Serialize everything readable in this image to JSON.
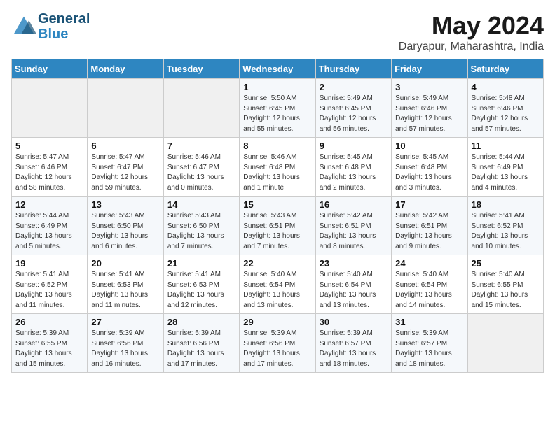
{
  "header": {
    "logo_line1": "General",
    "logo_line2": "Blue",
    "month_title": "May 2024",
    "location": "Daryapur, Maharashtra, India"
  },
  "days_of_week": [
    "Sunday",
    "Monday",
    "Tuesday",
    "Wednesday",
    "Thursday",
    "Friday",
    "Saturday"
  ],
  "weeks": [
    [
      {
        "day": "",
        "sunrise": "",
        "sunset": "",
        "daylight": ""
      },
      {
        "day": "",
        "sunrise": "",
        "sunset": "",
        "daylight": ""
      },
      {
        "day": "",
        "sunrise": "",
        "sunset": "",
        "daylight": ""
      },
      {
        "day": "1",
        "sunrise": "Sunrise: 5:50 AM",
        "sunset": "Sunset: 6:45 PM",
        "daylight": "Daylight: 12 hours and 55 minutes."
      },
      {
        "day": "2",
        "sunrise": "Sunrise: 5:49 AM",
        "sunset": "Sunset: 6:45 PM",
        "daylight": "Daylight: 12 hours and 56 minutes."
      },
      {
        "day": "3",
        "sunrise": "Sunrise: 5:49 AM",
        "sunset": "Sunset: 6:46 PM",
        "daylight": "Daylight: 12 hours and 57 minutes."
      },
      {
        "day": "4",
        "sunrise": "Sunrise: 5:48 AM",
        "sunset": "Sunset: 6:46 PM",
        "daylight": "Daylight: 12 hours and 57 minutes."
      }
    ],
    [
      {
        "day": "5",
        "sunrise": "Sunrise: 5:47 AM",
        "sunset": "Sunset: 6:46 PM",
        "daylight": "Daylight: 12 hours and 58 minutes."
      },
      {
        "day": "6",
        "sunrise": "Sunrise: 5:47 AM",
        "sunset": "Sunset: 6:47 PM",
        "daylight": "Daylight: 12 hours and 59 minutes."
      },
      {
        "day": "7",
        "sunrise": "Sunrise: 5:46 AM",
        "sunset": "Sunset: 6:47 PM",
        "daylight": "Daylight: 13 hours and 0 minutes."
      },
      {
        "day": "8",
        "sunrise": "Sunrise: 5:46 AM",
        "sunset": "Sunset: 6:48 PM",
        "daylight": "Daylight: 13 hours and 1 minute."
      },
      {
        "day": "9",
        "sunrise": "Sunrise: 5:45 AM",
        "sunset": "Sunset: 6:48 PM",
        "daylight": "Daylight: 13 hours and 2 minutes."
      },
      {
        "day": "10",
        "sunrise": "Sunrise: 5:45 AM",
        "sunset": "Sunset: 6:48 PM",
        "daylight": "Daylight: 13 hours and 3 minutes."
      },
      {
        "day": "11",
        "sunrise": "Sunrise: 5:44 AM",
        "sunset": "Sunset: 6:49 PM",
        "daylight": "Daylight: 13 hours and 4 minutes."
      }
    ],
    [
      {
        "day": "12",
        "sunrise": "Sunrise: 5:44 AM",
        "sunset": "Sunset: 6:49 PM",
        "daylight": "Daylight: 13 hours and 5 minutes."
      },
      {
        "day": "13",
        "sunrise": "Sunrise: 5:43 AM",
        "sunset": "Sunset: 6:50 PM",
        "daylight": "Daylight: 13 hours and 6 minutes."
      },
      {
        "day": "14",
        "sunrise": "Sunrise: 5:43 AM",
        "sunset": "Sunset: 6:50 PM",
        "daylight": "Daylight: 13 hours and 7 minutes."
      },
      {
        "day": "15",
        "sunrise": "Sunrise: 5:43 AM",
        "sunset": "Sunset: 6:51 PM",
        "daylight": "Daylight: 13 hours and 7 minutes."
      },
      {
        "day": "16",
        "sunrise": "Sunrise: 5:42 AM",
        "sunset": "Sunset: 6:51 PM",
        "daylight": "Daylight: 13 hours and 8 minutes."
      },
      {
        "day": "17",
        "sunrise": "Sunrise: 5:42 AM",
        "sunset": "Sunset: 6:51 PM",
        "daylight": "Daylight: 13 hours and 9 minutes."
      },
      {
        "day": "18",
        "sunrise": "Sunrise: 5:41 AM",
        "sunset": "Sunset: 6:52 PM",
        "daylight": "Daylight: 13 hours and 10 minutes."
      }
    ],
    [
      {
        "day": "19",
        "sunrise": "Sunrise: 5:41 AM",
        "sunset": "Sunset: 6:52 PM",
        "daylight": "Daylight: 13 hours and 11 minutes."
      },
      {
        "day": "20",
        "sunrise": "Sunrise: 5:41 AM",
        "sunset": "Sunset: 6:53 PM",
        "daylight": "Daylight: 13 hours and 11 minutes."
      },
      {
        "day": "21",
        "sunrise": "Sunrise: 5:41 AM",
        "sunset": "Sunset: 6:53 PM",
        "daylight": "Daylight: 13 hours and 12 minutes."
      },
      {
        "day": "22",
        "sunrise": "Sunrise: 5:40 AM",
        "sunset": "Sunset: 6:54 PM",
        "daylight": "Daylight: 13 hours and 13 minutes."
      },
      {
        "day": "23",
        "sunrise": "Sunrise: 5:40 AM",
        "sunset": "Sunset: 6:54 PM",
        "daylight": "Daylight: 13 hours and 13 minutes."
      },
      {
        "day": "24",
        "sunrise": "Sunrise: 5:40 AM",
        "sunset": "Sunset: 6:54 PM",
        "daylight": "Daylight: 13 hours and 14 minutes."
      },
      {
        "day": "25",
        "sunrise": "Sunrise: 5:40 AM",
        "sunset": "Sunset: 6:55 PM",
        "daylight": "Daylight: 13 hours and 15 minutes."
      }
    ],
    [
      {
        "day": "26",
        "sunrise": "Sunrise: 5:39 AM",
        "sunset": "Sunset: 6:55 PM",
        "daylight": "Daylight: 13 hours and 15 minutes."
      },
      {
        "day": "27",
        "sunrise": "Sunrise: 5:39 AM",
        "sunset": "Sunset: 6:56 PM",
        "daylight": "Daylight: 13 hours and 16 minutes."
      },
      {
        "day": "28",
        "sunrise": "Sunrise: 5:39 AM",
        "sunset": "Sunset: 6:56 PM",
        "daylight": "Daylight: 13 hours and 17 minutes."
      },
      {
        "day": "29",
        "sunrise": "Sunrise: 5:39 AM",
        "sunset": "Sunset: 6:56 PM",
        "daylight": "Daylight: 13 hours and 17 minutes."
      },
      {
        "day": "30",
        "sunrise": "Sunrise: 5:39 AM",
        "sunset": "Sunset: 6:57 PM",
        "daylight": "Daylight: 13 hours and 18 minutes."
      },
      {
        "day": "31",
        "sunrise": "Sunrise: 5:39 AM",
        "sunset": "Sunset: 6:57 PM",
        "daylight": "Daylight: 13 hours and 18 minutes."
      },
      {
        "day": "",
        "sunrise": "",
        "sunset": "",
        "daylight": ""
      }
    ]
  ]
}
